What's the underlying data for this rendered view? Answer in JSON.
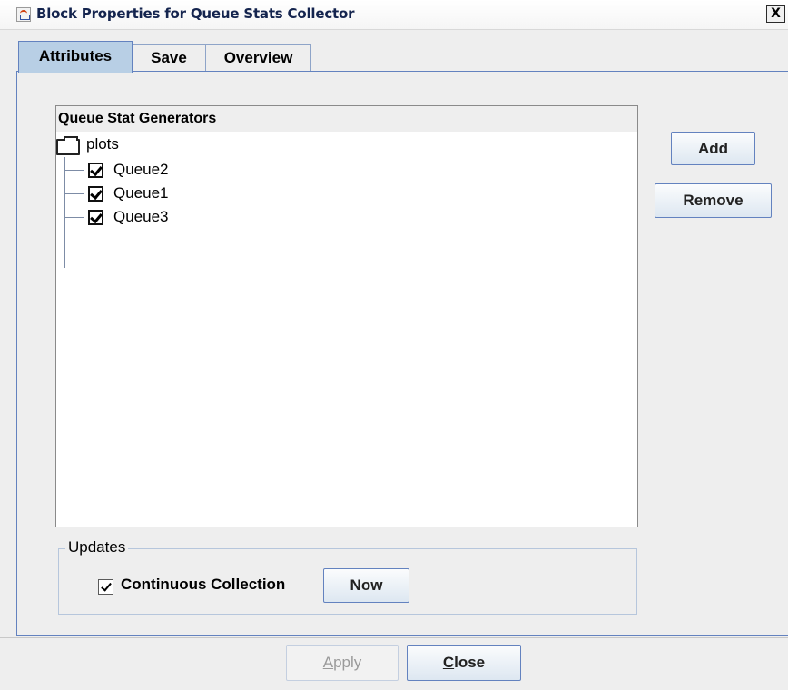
{
  "window": {
    "title": "Block Properties for Queue Stats Collector",
    "close_symbol": "X"
  },
  "tabs": [
    {
      "label": "Attributes",
      "active": true
    },
    {
      "label": "Save",
      "active": false
    },
    {
      "label": "Overview",
      "active": false
    }
  ],
  "tree": {
    "header": "Queue Stat Generators",
    "root": {
      "label": "plots",
      "icon": "folder-icon"
    },
    "items": [
      {
        "label": "Queue2",
        "checked": true
      },
      {
        "label": "Queue1",
        "checked": true
      },
      {
        "label": "Queue3",
        "checked": true
      }
    ]
  },
  "side_buttons": {
    "add": "Add",
    "remove": "Remove"
  },
  "updates": {
    "title": "Updates",
    "continuous_label": "Continuous Collection",
    "continuous_checked": true,
    "now_label": "Now"
  },
  "footer": {
    "apply": {
      "mnemonic": "A",
      "rest": "pply",
      "enabled": false
    },
    "close": {
      "mnemonic": "C",
      "rest": "lose",
      "enabled": true
    }
  },
  "colors": {
    "active_tab": "#b8cfe5",
    "border_accent": "#6382bf",
    "title_text": "#14244e",
    "panel_bg": "#eeeeee"
  }
}
